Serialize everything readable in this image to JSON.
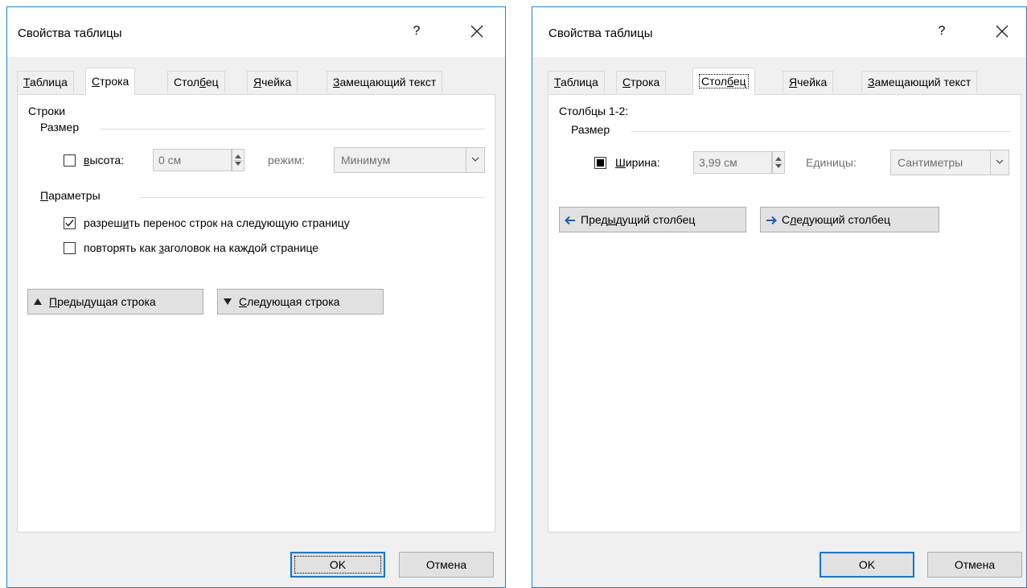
{
  "left_dialog": {
    "title": "Свойства таблицы",
    "help": "?",
    "tabs": [
      {
        "pre": "",
        "u": "Т",
        "post": "аблица"
      },
      {
        "pre": "",
        "u": "С",
        "post": "трока"
      },
      {
        "pre": "Стол",
        "u": "б",
        "post": "ец"
      },
      {
        "pre": "",
        "u": "Я",
        "post": "чейка"
      },
      {
        "pre": "",
        "u": "З",
        "post": "амещающий текст"
      }
    ],
    "active_tab": "Строка",
    "section_title": "Строки",
    "size_group": "Размер",
    "height_label": {
      "u": "в",
      "post": "ысота:"
    },
    "height_value": "0 см",
    "mode_label": "режим:",
    "mode_value": "Минимум",
    "params_group": {
      "u": "П",
      "post": "араметры"
    },
    "allow_break": {
      "pre": "разреш",
      "u": "и",
      "post": "ть перенос строк на следующую страницу"
    },
    "repeat_header": {
      "pre": "повторять как ",
      "u": "з",
      "post": "аголовок на каждой странице"
    },
    "prev_row": {
      "u": "П",
      "post": "редыдущая строка"
    },
    "next_row": {
      "u": "С",
      "post": "ледующая строка"
    },
    "ok": "OK",
    "cancel": "Отмена"
  },
  "right_dialog": {
    "title": "Свойства таблицы",
    "help": "?",
    "tabs": [
      {
        "pre": "",
        "u": "Т",
        "post": "аблица"
      },
      {
        "pre": "",
        "u": "С",
        "post": "трока"
      },
      {
        "pre": "Стол",
        "u": "б",
        "post": "ец"
      },
      {
        "pre": "",
        "u": "Я",
        "post": "чейка"
      },
      {
        "pre": "",
        "u": "З",
        "post": "амещающий текст"
      }
    ],
    "active_tab": "Столбец",
    "section_title": "Столбцы 1-2:",
    "size_group": "Размер",
    "width_label": {
      "u": "Ш",
      "post": "ирина:"
    },
    "width_value": "3,99 см",
    "units_label": "Единицы:",
    "units_value": "Сантиметры",
    "prev_col": {
      "pre": "Пред",
      "u": "ы",
      "post": "дущий столбец"
    },
    "next_col": {
      "pre": "С",
      "u": "л",
      "post": "едующий столбец"
    },
    "ok": "OK",
    "cancel": "Отмена"
  },
  "colors": {
    "accent": "#0078d7",
    "border": "#1883d7"
  },
  "icons": [
    "close-icon",
    "chevron-down-icon",
    "spin-up-icon",
    "spin-down-icon",
    "arrow-left-icon",
    "arrow-right-icon",
    "triangle-up-icon",
    "triangle-down-icon",
    "check-icon"
  ]
}
